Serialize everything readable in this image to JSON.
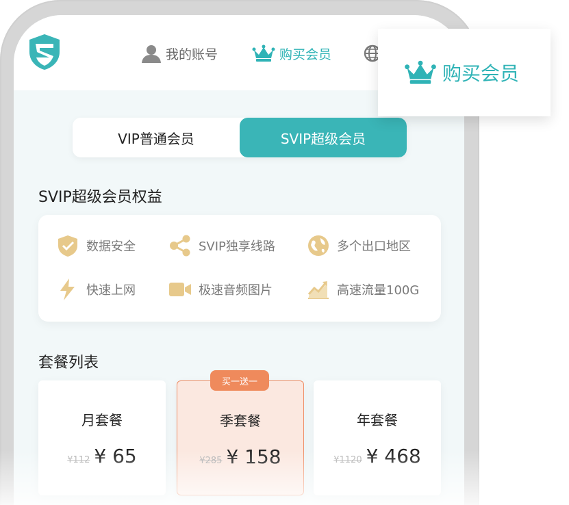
{
  "nav": {
    "account_label": "我的账号",
    "buy_label": "购买会员",
    "popup_label": "购买会员"
  },
  "tabs": [
    {
      "label": "VIP普通会员",
      "active": false
    },
    {
      "label": "SVIP超级会员",
      "active": true
    }
  ],
  "benefits_title": "SVIP超级会员权益",
  "benefits": [
    {
      "icon": "shield-check-icon",
      "label": "数据安全"
    },
    {
      "icon": "share-nodes-icon",
      "label": "SVIP独享线路"
    },
    {
      "icon": "globe-icon",
      "label": "多个出口地区"
    },
    {
      "icon": "lightning-icon",
      "label": "快速上网"
    },
    {
      "icon": "video-camera-icon",
      "label": "极速音频图片"
    },
    {
      "icon": "trend-chart-icon",
      "label": "高速流量100G"
    }
  ],
  "plans_title": "套餐列表",
  "plans": [
    {
      "name": "月套餐",
      "old_price": "¥112",
      "price": "¥ 65",
      "featured": false
    },
    {
      "name": "季套餐",
      "old_price": "¥285",
      "price": "¥ 158",
      "featured": true,
      "badge": "买一送一"
    },
    {
      "name": "年套餐",
      "old_price": "¥1120",
      "price": "¥ 468",
      "featured": false
    }
  ],
  "colors": {
    "accent": "#3ab5b7",
    "promo": "#ef8a5c",
    "featured_bg": "#fbe8e0",
    "icon_gold": "#e7c98b"
  }
}
